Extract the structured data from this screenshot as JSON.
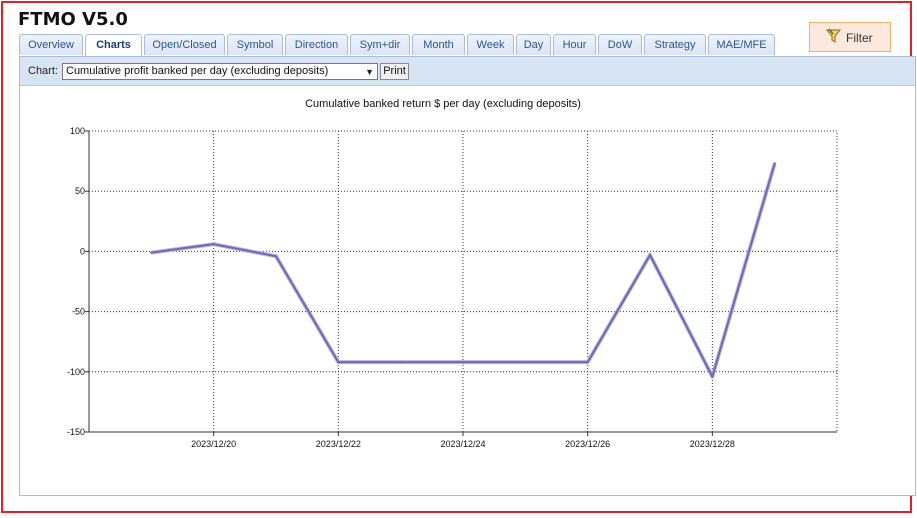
{
  "app": {
    "title": "FTMO V5.0"
  },
  "tabs": [
    {
      "label": "Overview",
      "active": false
    },
    {
      "label": "Charts",
      "active": true
    },
    {
      "label": "Open/Closed",
      "active": false
    },
    {
      "label": "Symbol",
      "active": false
    },
    {
      "label": "Direction",
      "active": false
    },
    {
      "label": "Sym+dir",
      "active": false
    },
    {
      "label": "Month",
      "active": false
    },
    {
      "label": "Week",
      "active": false
    },
    {
      "label": "Day",
      "active": false
    },
    {
      "label": "Hour",
      "active": false
    },
    {
      "label": "DoW",
      "active": false
    },
    {
      "label": "Strategy",
      "active": false
    },
    {
      "label": "MAE/MFE",
      "active": false
    }
  ],
  "filter": {
    "label": "Filter",
    "icon": "funnel-icon"
  },
  "toolbar": {
    "chart_label": "Chart:",
    "selected_chart": "Cumulative profit banked per day (excluding deposits)",
    "print_label": "Print"
  },
  "colors": {
    "line": "#6b6bb8",
    "frame": "#e0202a",
    "tab_text": "#2c5590"
  },
  "chart_data": {
    "type": "line",
    "title": "Cumulative banked return $ per day (excluding deposits)",
    "xlabel": "",
    "ylabel": "",
    "x": [
      "2023/12/19",
      "2023/12/20",
      "2023/12/21",
      "2023/12/22",
      "2023/12/23",
      "2023/12/24",
      "2023/12/25",
      "2023/12/26",
      "2023/12/27",
      "2023/12/28",
      "2023/12/29"
    ],
    "series": [
      {
        "values": [
          -1,
          6,
          -4,
          -92,
          -92,
          -92,
          -92,
          -92,
          -3,
          -104,
          73
        ]
      }
    ],
    "ylim": [
      -150,
      100
    ],
    "yticks": [
      "100",
      "50",
      "0",
      "-50",
      "-100",
      "-150"
    ],
    "xtick_labels": [
      "2023/12/20",
      "2023/12/22",
      "2023/12/24",
      "2023/12/26",
      "2023/12/28"
    ],
    "grid": true
  }
}
